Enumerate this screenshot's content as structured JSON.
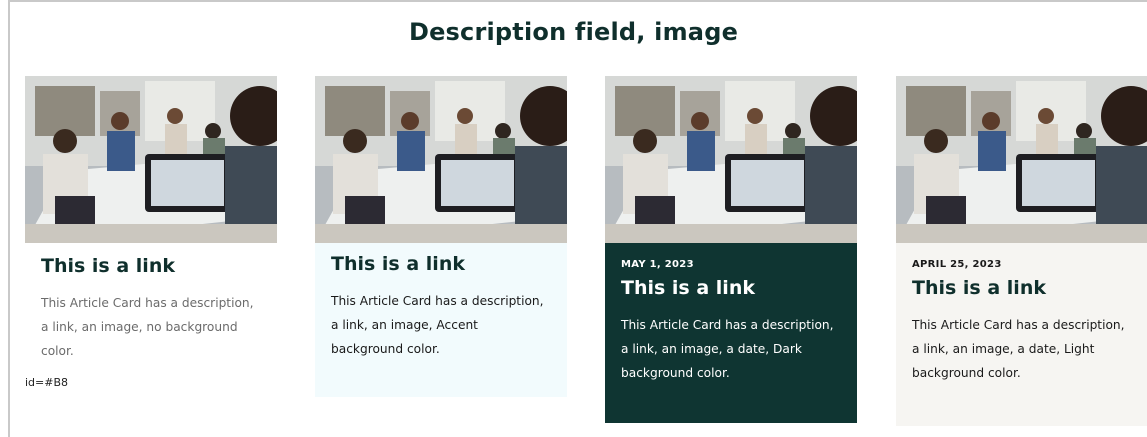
{
  "page": {
    "title": "Description field, image"
  },
  "cards": [
    {
      "link": "This is a link",
      "description": "This Article Card has a description, a link, an image, no background color.",
      "background": "none",
      "image_alt": "People in a meeting using a tablet"
    },
    {
      "link": "This is a link",
      "description": "This Article Card has a description, a link, an image, Accent background color.",
      "background": "#f2fbfd",
      "image_alt": "People in a meeting using a tablet"
    },
    {
      "date": "MAY 1, 2023",
      "link": "This is a link",
      "description": "This Article Card has a description, a link, an image, a date, Dark background color.",
      "background": "#0f3532",
      "image_alt": "People in a meeting using a tablet"
    },
    {
      "date": "APRIL 25, 2023",
      "link": "This is a link",
      "description": "This Article Card has a description, a link, an image, a date, Light background color.",
      "background": "#f6f5f2",
      "image_alt": "People in a meeting using a tablet"
    }
  ],
  "id_tag": "id=#B8",
  "colors": {
    "title": "#0f2f2c",
    "accent_bg": "#f2fbfd",
    "dark_bg": "#0f3532",
    "light_bg": "#f6f5f2"
  }
}
